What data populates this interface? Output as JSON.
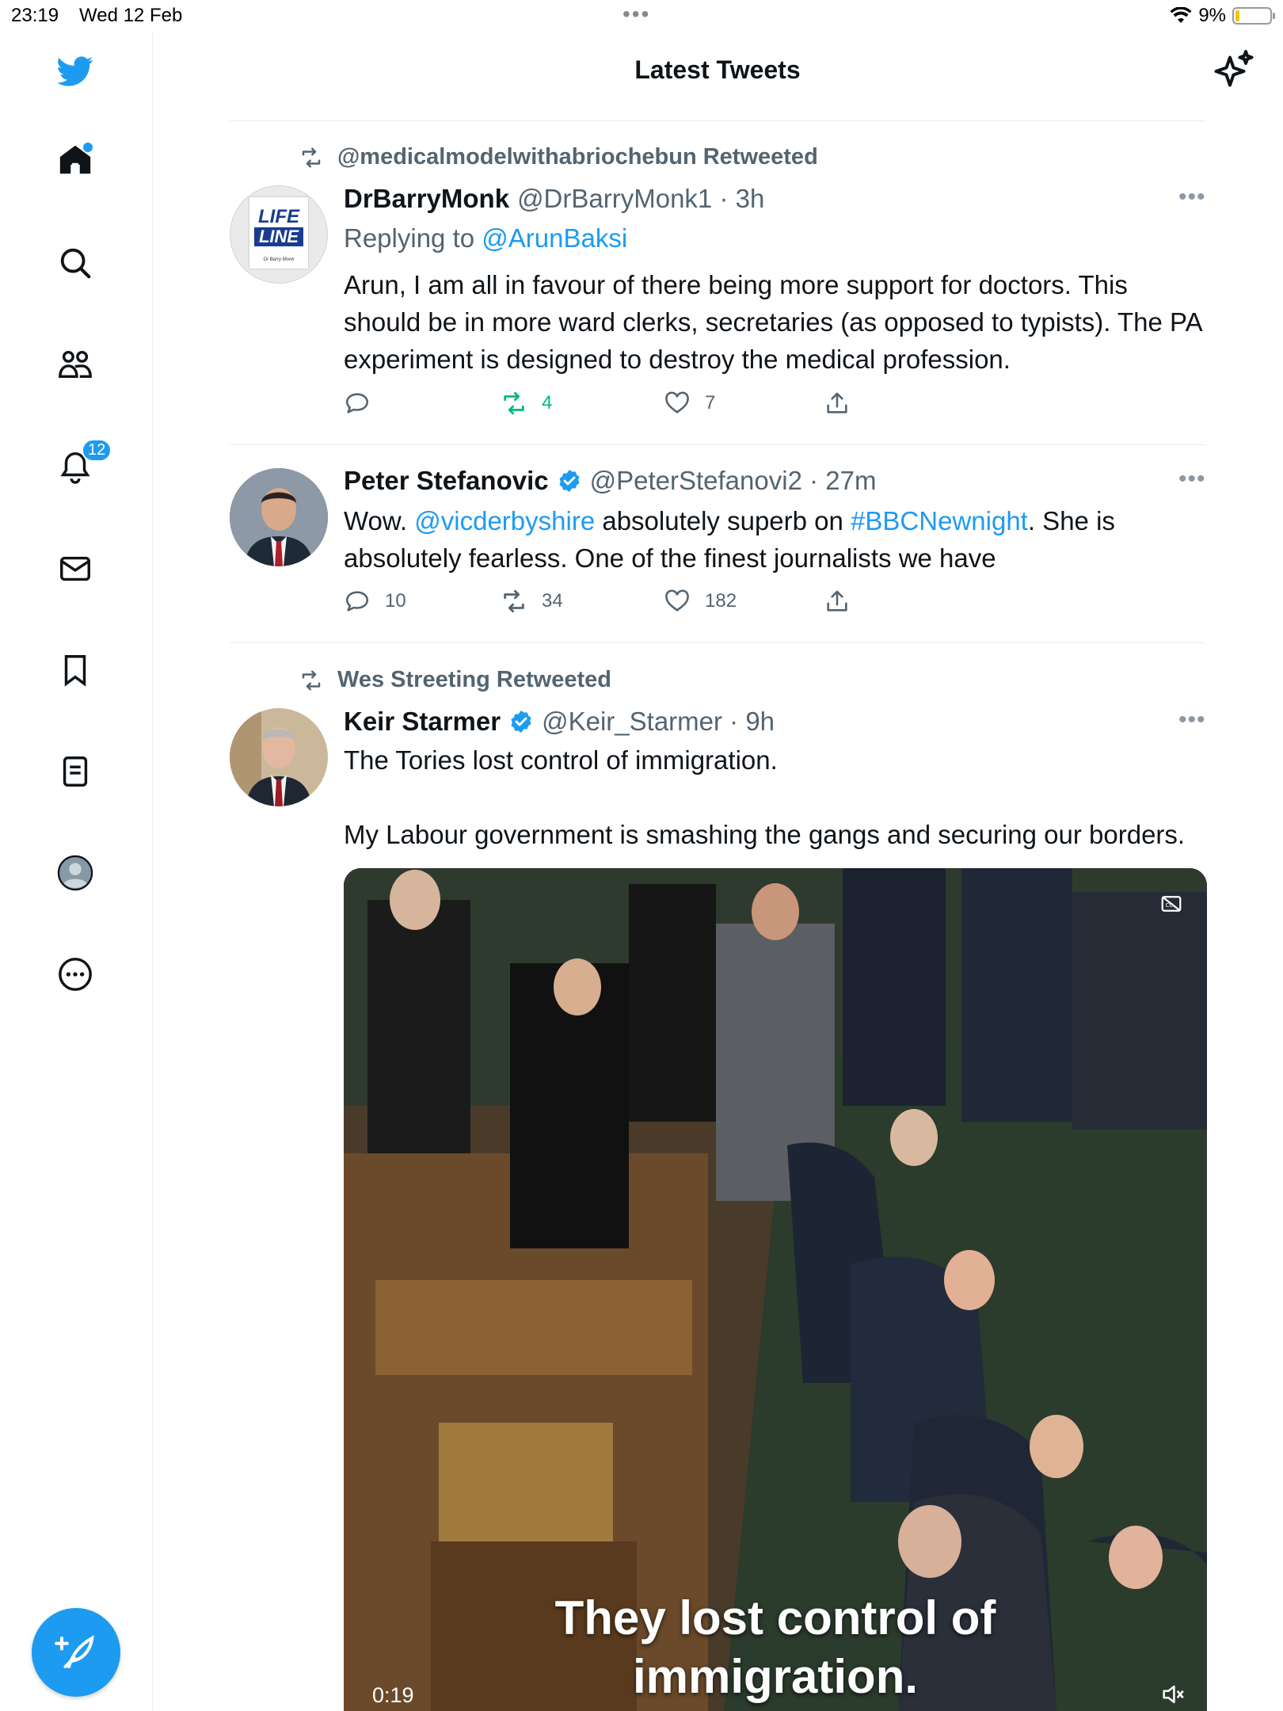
{
  "status_bar": {
    "time": "23:19",
    "date": "Wed 12 Feb",
    "battery": "9%"
  },
  "header": {
    "title": "Latest Tweets"
  },
  "sidebar": {
    "notifications_count": "12",
    "items": [
      "home",
      "explore",
      "communities",
      "notifications",
      "messages",
      "bookmarks",
      "lists",
      "profile",
      "more"
    ]
  },
  "tweets": [
    {
      "retweeted_by": "@medicalmodelwithabriochebun Retweeted",
      "name": "DrBarryMonk",
      "handle": "@DrBarryMonk1 · 3h",
      "reply_prefix": "Replying to ",
      "reply_to": "@ArunBaksi",
      "text": "Arun, I am all in favour of there being more support for doctors. This should be in more ward clerks, secretaries (as opposed to typists). The PA experiment is designed to destroy the medical profession.",
      "replies": "",
      "retweets": "4",
      "likes": "7",
      "avatar_text_1": "LIFE",
      "avatar_text_2": "LINE",
      "avatar_text_3": "Dr Barry Monk"
    },
    {
      "name": "Peter Stefanovic",
      "handle": "@PeterStefanovi2 · 27m",
      "text_1": "Wow. ",
      "mention": "@vicderbyshire",
      "text_2": " absolutely superb on ",
      "hashtag": "#BBCNewnight",
      "text_3": ". She is absolutely fearless. One of the finest journalists we have",
      "replies": "10",
      "retweets": "34",
      "likes": "182"
    },
    {
      "retweeted_by": "Wes Streeting Retweeted",
      "name": "Keir Starmer",
      "handle": "@Keir_Starmer · 9h",
      "text": "The Tories lost control of immigration.\n\nMy Labour government is smashing the gangs and securing our borders.",
      "video_caption_1": "They lost control of",
      "video_caption_2": "immigration.",
      "video_time": "0:19"
    }
  ],
  "colors": {
    "accent": "#1d9bf0",
    "retweet_green": "#00ba7c",
    "secondary_text": "#536471"
  }
}
